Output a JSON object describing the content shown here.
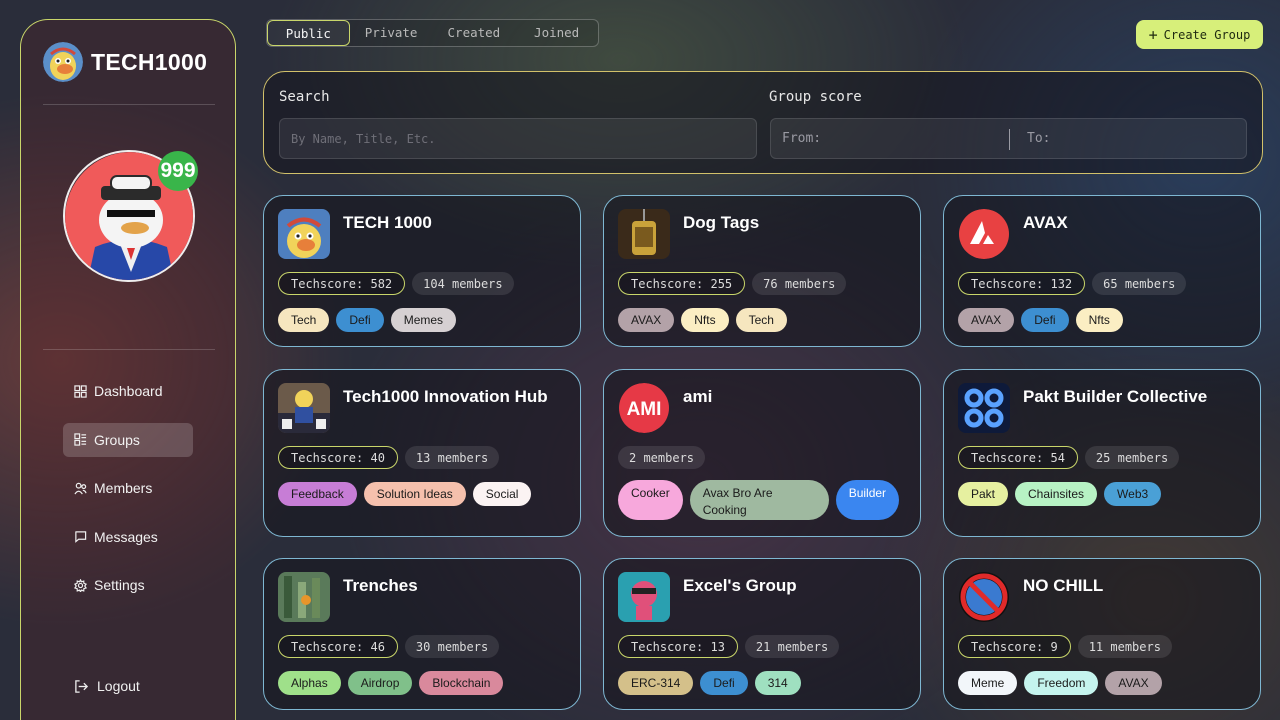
{
  "brand": {
    "name": "TECH1000"
  },
  "user": {
    "badge": "999"
  },
  "nav": {
    "items": [
      {
        "label": "Dashboard",
        "icon": "dashboard-icon"
      },
      {
        "label": "Groups",
        "icon": "groups-icon"
      },
      {
        "label": "Members",
        "icon": "members-icon"
      },
      {
        "label": "Messages",
        "icon": "messages-icon"
      },
      {
        "label": "Settings",
        "icon": "settings-icon"
      }
    ],
    "logout": "Logout"
  },
  "tabs": [
    "Public",
    "Private",
    "Created",
    "Joined"
  ],
  "create_button": "Create Group",
  "search": {
    "label": "Search",
    "placeholder": "By Name, Title, Etc.",
    "score_label": "Group score",
    "from_label": "From:",
    "to_label": "To:"
  },
  "groups": [
    {
      "title": "TECH 1000",
      "score": "Techscore: 582",
      "members": "104 members",
      "tags": [
        "Tech",
        "Defi",
        "Memes"
      ]
    },
    {
      "title": "Dog Tags",
      "score": "Techscore: 255",
      "members": "76 members",
      "tags": [
        "AVAX",
        "Nfts",
        "Tech"
      ]
    },
    {
      "title": "AVAX",
      "score": "Techscore: 132",
      "members": "65 members",
      "tags": [
        "AVAX",
        "Defi",
        "Nfts"
      ]
    },
    {
      "title": "Tech1000 Innovation Hub",
      "score": "Techscore: 40",
      "members": "13 members",
      "tags": [
        "Feedback",
        "Solution Ideas",
        "Social"
      ]
    },
    {
      "title": "ami",
      "score": "",
      "members": "2 members",
      "tags": [
        "Cooker",
        "Avax Bro Are Cooking",
        "Builder"
      ]
    },
    {
      "title": "Pakt Builder Collective",
      "score": "Techscore: 54",
      "members": "25 members",
      "tags": [
        "Pakt",
        "Chainsites",
        "Web3"
      ]
    },
    {
      "title": "Trenches",
      "score": "Techscore: 46",
      "members": "30 members",
      "tags": [
        "Alphas",
        "Airdrop",
        "Blockchain"
      ]
    },
    {
      "title": "Excel's Group",
      "score": "Techscore: 13",
      "members": "21 members",
      "tags": [
        "ERC-314",
        "Defi",
        "314"
      ]
    },
    {
      "title": "NO CHILL",
      "score": "Techscore: 9",
      "members": "11 members",
      "tags": [
        "Meme",
        "Freedom",
        "AVAX"
      ]
    }
  ],
  "colors": {
    "accent": "#c9d66a",
    "create_button": "#d7ef7a",
    "card_border": "#7eb7d2",
    "badge_green": "#39b54a"
  }
}
